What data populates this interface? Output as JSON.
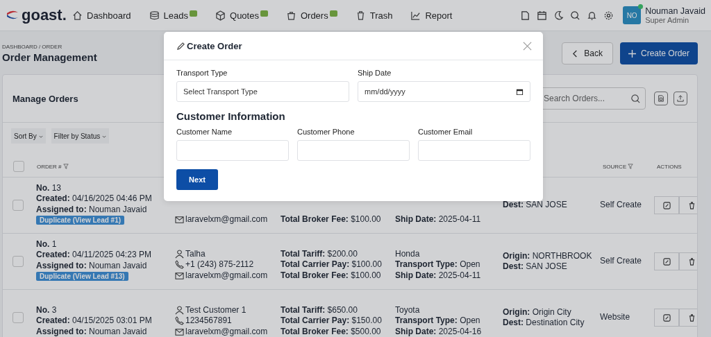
{
  "nav": {
    "logo": "goast.",
    "items": [
      {
        "label": "Dashboard",
        "badge": false
      },
      {
        "label": "Leads",
        "badge": true
      },
      {
        "label": "Quotes",
        "badge": true
      },
      {
        "label": "Orders",
        "badge": true
      },
      {
        "label": "Trash",
        "badge": false
      },
      {
        "label": "Report",
        "badge": false
      }
    ],
    "user": {
      "initials": "NO",
      "name": "Nouman Javaid",
      "role": "Super Admin",
      "online": true
    }
  },
  "breadcrumb": "DASHBOARD / ORDER",
  "page_title": "Order Management",
  "actions": {
    "back": "Back",
    "create": "Create Order"
  },
  "card": {
    "title": "Manage Orders",
    "search": {
      "placeholder": "Search Orders..."
    },
    "filters": [
      "Sort By",
      "Filter by Status"
    ],
    "select_all": {
      "checked": false
    },
    "columns": [
      {
        "label": "ORDER #"
      },
      {
        "label": "SOURCE"
      },
      {
        "label": "ACTIONS"
      }
    ],
    "rows": [
      {
        "checked": false,
        "order": [
          {
            "label": "No.",
            "value": "13"
          },
          {
            "label": "Created:",
            "value": "04/16/2025 04:46 PM"
          },
          {
            "label": "Assigned to:",
            "value": "Nouman Javaid"
          }
        ],
        "duplicate": "Duplicate (View Lead #1)",
        "customer": [
          {
            "kind": "email",
            "text": "laravelxm@gmail.com"
          }
        ],
        "pricing": [
          {
            "label": "Total Broker Fee:",
            "value": "$100.00"
          }
        ],
        "vehicle": [
          {
            "label": "Ship Date:",
            "value": "2025-04-11"
          }
        ],
        "route": [
          {
            "label": "Dest:",
            "value": "SAN JOSE"
          }
        ],
        "source": "Self Create"
      },
      {
        "checked": false,
        "order": [
          {
            "label": "No.",
            "value": "1"
          },
          {
            "label": "Created:",
            "value": "04/11/2025 04:23 PM"
          },
          {
            "label": "Assigned to:",
            "value": "Nouman Javaid"
          }
        ],
        "duplicate": "Duplicate (View Lead #13)",
        "customer": [
          {
            "kind": "person",
            "text": "Talha"
          },
          {
            "kind": "phone",
            "text": "+1 (243) 875-2112"
          },
          {
            "kind": "email",
            "text": "laravelxm@gmail.com"
          }
        ],
        "pricing": [
          {
            "label": "Total Tariff:",
            "value": "$200.00"
          },
          {
            "label": "Total Carrier Pay:",
            "value": "$100.00"
          },
          {
            "label": "Total Broker Fee:",
            "value": "$100.00"
          }
        ],
        "vehicle": [
          {
            "value": "Honda"
          },
          {
            "label": "Transport Type:",
            "value": "Open"
          },
          {
            "label": "Ship Date:",
            "value": "2025-04-11"
          }
        ],
        "route": [
          {
            "label": "Origin:",
            "value": "NORTHBROOK"
          },
          {
            "label": "Dest:",
            "value": "SAN JOSE"
          }
        ],
        "source": "Self Create"
      },
      {
        "checked": false,
        "order": [
          {
            "label": "No.",
            "value": "3"
          },
          {
            "label": "Created:",
            "value": "04/15/2025 03:01 PM"
          },
          {
            "label": "Assigned to:",
            "value": "Nouman Javaid"
          }
        ],
        "customer": [
          {
            "kind": "person",
            "text": "Test Customer 1"
          },
          {
            "kind": "phone",
            "text": "1234567891"
          },
          {
            "kind": "email",
            "text": "laravelxm@gmail.com"
          }
        ],
        "pricing": [
          {
            "label": "Total Tariff:",
            "value": "$650.00"
          },
          {
            "label": "Total Carrier Pay:",
            "value": "$150.00"
          },
          {
            "label": "Total Broker Fee:",
            "value": "$500.00"
          }
        ],
        "vehicle": [
          {
            "value": "Toyota"
          },
          {
            "label": "Transport Type:",
            "value": "Open"
          },
          {
            "label": "Ship Date:",
            "value": "2025-04-16"
          }
        ],
        "route": [
          {
            "label": "Origin:",
            "value": "Origin City"
          },
          {
            "label": "Dest:",
            "value": "Destination City"
          }
        ],
        "source": "Website"
      }
    ]
  },
  "modal": {
    "title": "Create Order",
    "fields": [
      {
        "kind": "select",
        "label": "Transport Type",
        "placeholder": "Select Transport Type"
      },
      {
        "kind": "date",
        "label": "Ship Date",
        "placeholder": "mm/dd/yyyy"
      }
    ],
    "section": "Customer Information",
    "customer_fields": [
      {
        "kind": "text",
        "label": "Customer Name"
      },
      {
        "kind": "text",
        "label": "Customer Phone"
      },
      {
        "kind": "text",
        "label": "Customer Email"
      }
    ],
    "button": "Next"
  }
}
